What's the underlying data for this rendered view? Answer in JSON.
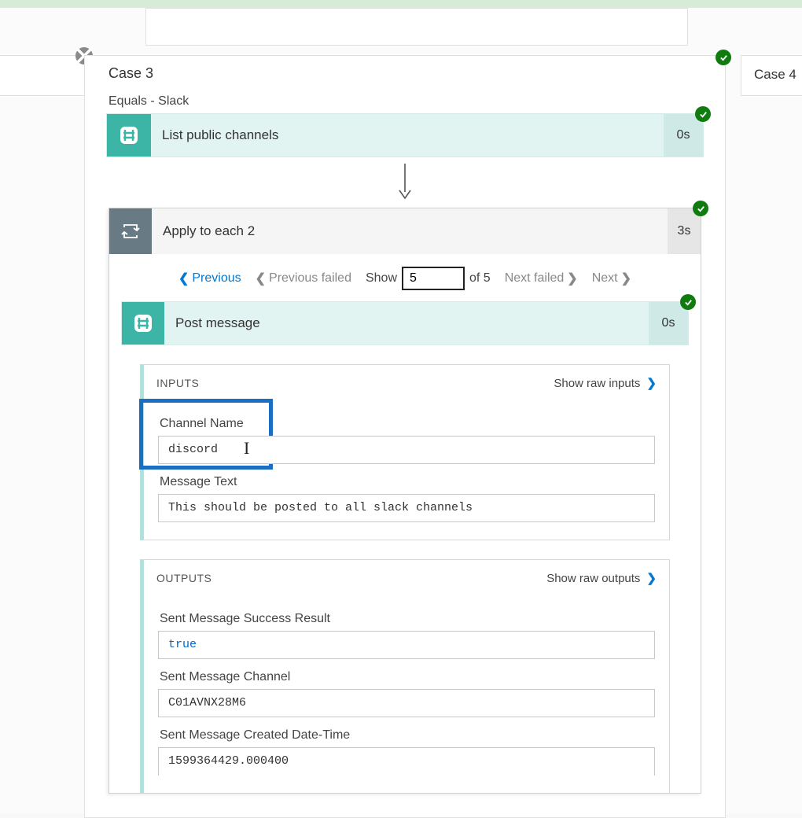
{
  "case3": {
    "title": "Case 3",
    "subtitle": "Equals - Slack"
  },
  "case4": {
    "title": "Case 4"
  },
  "listChannels": {
    "title": "List public channels",
    "duration": "0s"
  },
  "applyEach": {
    "title": "Apply to each 2",
    "duration": "3s"
  },
  "pager": {
    "previous": "Previous",
    "previousFailed": "Previous failed",
    "showLabel": "Show",
    "showValue": "5",
    "ofLabel": "of 5",
    "nextFailed": "Next failed",
    "next": "Next"
  },
  "postMessage": {
    "title": "Post message",
    "duration": "0s",
    "inputs": {
      "sectionLabel": "INPUTS",
      "rawLink": "Show raw inputs",
      "fields": {
        "channelName": {
          "label": "Channel Name",
          "value": "discord"
        },
        "messageText": {
          "label": "Message Text",
          "value": "This should be posted to all slack channels"
        }
      }
    },
    "outputs": {
      "sectionLabel": "OUTPUTS",
      "rawLink": "Show raw outputs",
      "fields": {
        "successResult": {
          "label": "Sent Message Success Result",
          "value": "true"
        },
        "channel": {
          "label": "Sent Message Channel",
          "value": "C01AVNX28M6"
        },
        "createdDateTime": {
          "label": "Sent Message Created Date-Time",
          "value": "1599364429.000400"
        }
      }
    }
  }
}
